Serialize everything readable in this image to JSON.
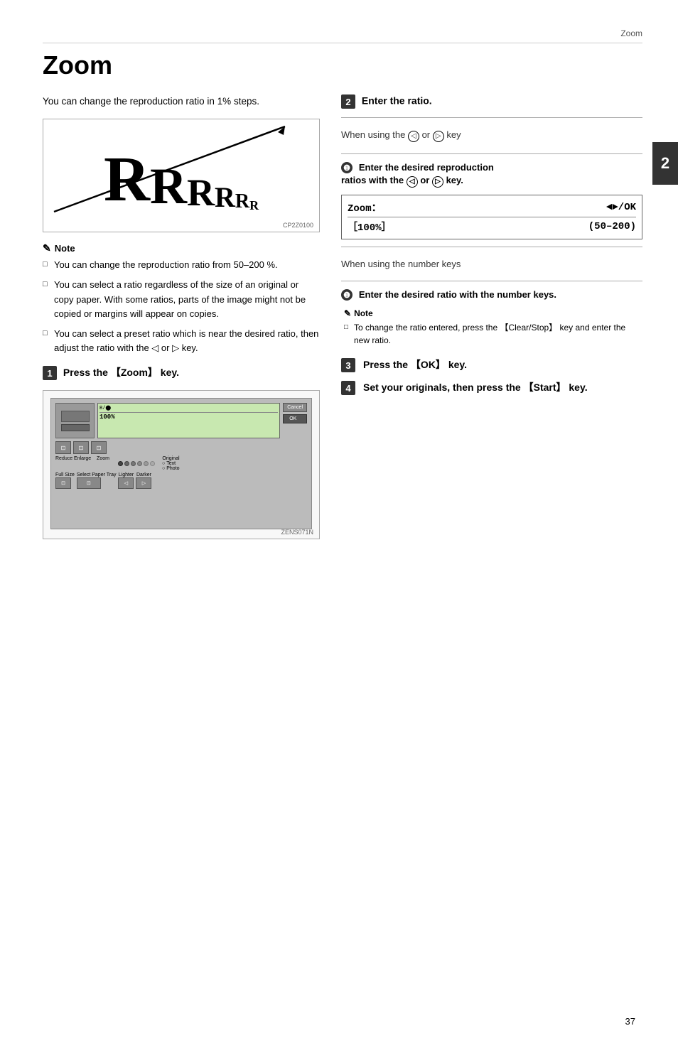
{
  "page": {
    "header": "Zoom",
    "chapter": "2",
    "page_number": "37"
  },
  "title": "Zoom",
  "intro": "You can change the reproduction ratio in 1% steps.",
  "zoom_image_code": "CP2Z0100",
  "notes_left": {
    "title": "Note",
    "items": [
      "You can change the reproduction ratio from 50–200 %.",
      "You can select a ratio regardless of the size of an original or copy paper. With some ratios, parts of the image might not be copied or margins will appear on copies.",
      "You can select a preset ratio which is near the desired ratio, then adjust the ratio with the ◁ or ▷ key."
    ]
  },
  "step1": {
    "number": "1",
    "text": "Press the 【Zoom】 key."
  },
  "panel_image_code": "ZENS071N",
  "step2": {
    "number": "2",
    "text": "Enter the ratio."
  },
  "context1": {
    "label": "When using the ◁ or ▷ key"
  },
  "sub_step1": {
    "number": "1",
    "text": "Enter the desired reproduction ratios with the ◁ or ▷ key."
  },
  "zoom_display": {
    "row1_left": "Zoom：",
    "row1_right": "◄►/OK",
    "row2_left": "［100%］",
    "row2_right": "(50–200)"
  },
  "context2": {
    "label": "When using the number keys"
  },
  "sub_step2": {
    "number": "1",
    "text": "Enter the desired ratio with the number keys."
  },
  "note_right": {
    "title": "Note",
    "items": [
      "To change the ratio entered, press the 【Clear/Stop】 key and enter the new ratio."
    ]
  },
  "step3": {
    "number": "3",
    "text": "Press the 【OK】 key."
  },
  "step4": {
    "number": "4",
    "text": "Set your originals, then press the 【Start】 key."
  },
  "panel_labels": {
    "reduce": "Reduce",
    "enlarge": "Enlarge",
    "zoom": "Zoom",
    "full_size": "Full Size",
    "select_paper_tray": "Select Paper Tray",
    "lighter": "Lighter",
    "darker": "Darker",
    "original": "Original",
    "text": "Text",
    "photo": "Photo",
    "cancel": "Cancel",
    "ok": "OK"
  }
}
